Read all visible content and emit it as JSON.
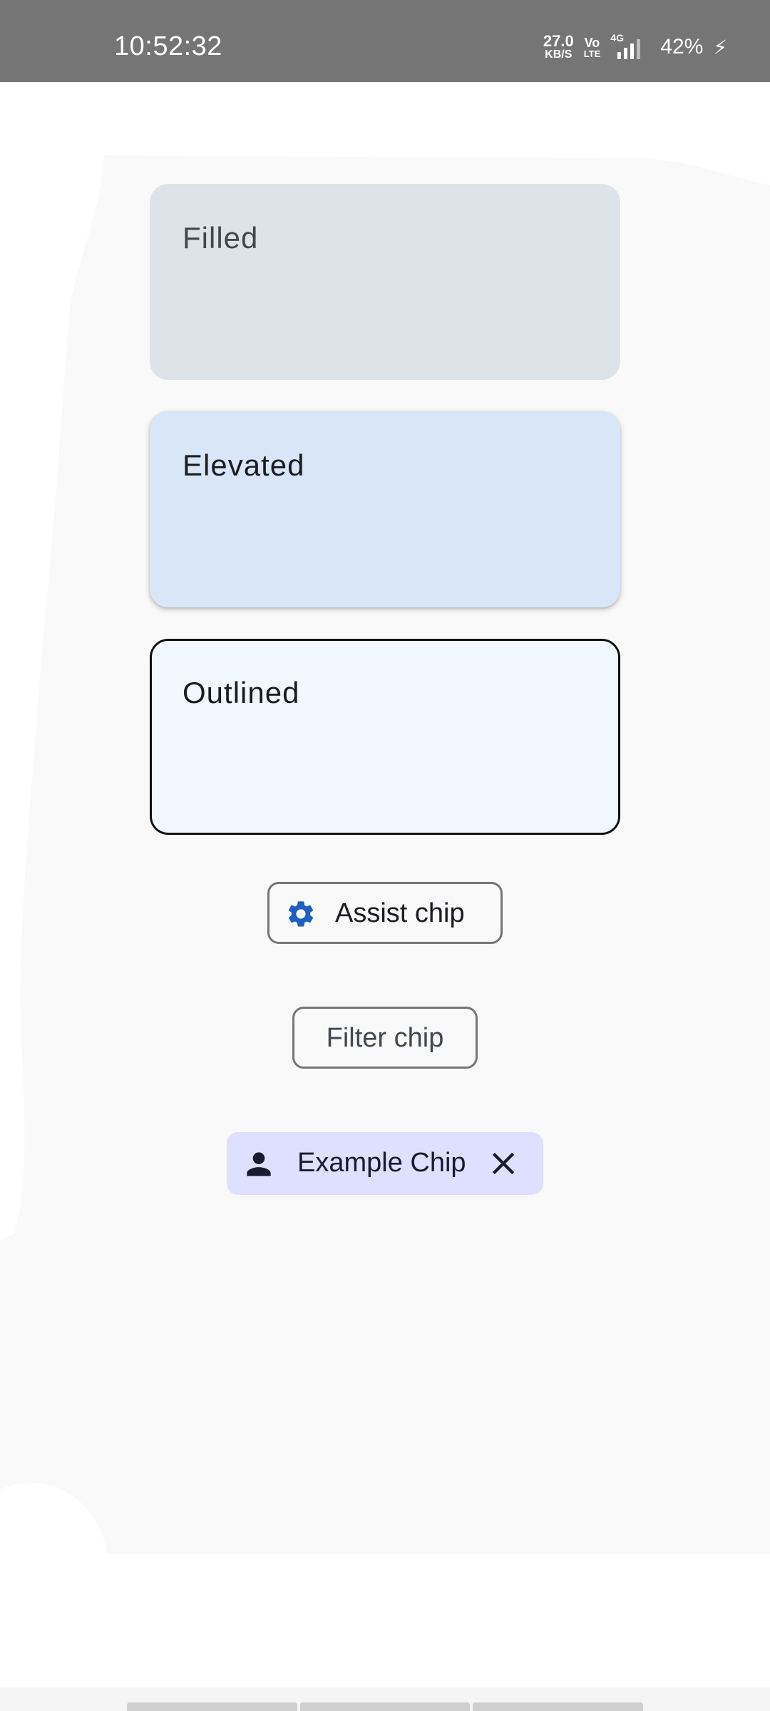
{
  "status_bar": {
    "time": "10:52:32",
    "net_speed_value": "27.0",
    "net_speed_unit": "KB/S",
    "volte_top": "Vo",
    "volte_bottom": "LTE",
    "network_type": "4G",
    "battery_percent": "42%",
    "icons": [
      "signal-icon",
      "charging-bolt-icon"
    ]
  },
  "cards": {
    "filled": {
      "label": "Filled",
      "color": "#dee3e9"
    },
    "elevated": {
      "label": "Elevated",
      "color": "#d8e6f7"
    },
    "outlined": {
      "label": "Outlined",
      "color": "#f1f8ff"
    }
  },
  "chips": {
    "assist": {
      "label": "Assist chip",
      "icon": "gear-icon",
      "icon_color": "#1f5fbf"
    },
    "filter": {
      "label": "Filter chip"
    },
    "input": {
      "label": "Example Chip",
      "leading_icon": "person-icon",
      "trailing_icon": "close-icon",
      "color": "#dfe0ff"
    }
  }
}
